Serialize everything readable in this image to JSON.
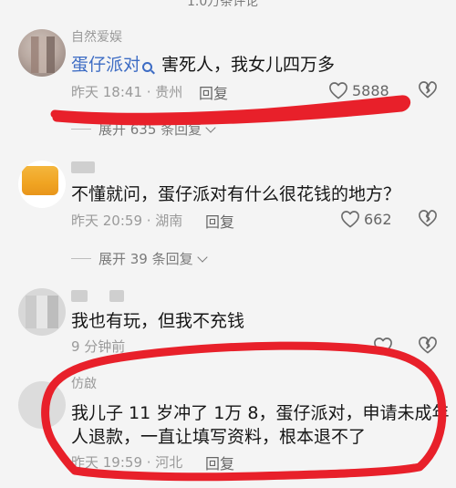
{
  "topbar": {
    "title": "1.0万条评论"
  },
  "comments": [
    {
      "username": "自然爱娱",
      "mention": "蛋仔派对",
      "text": " 害死人，我女儿四万多",
      "time": "昨天 18:41 · 贵州",
      "reply": "回复",
      "likes": "5888"
    },
    {
      "expand_hidden": "展开 635 条回复",
      "username": "",
      "text": "不懂就问，蛋仔派对有什么很花钱的地方？",
      "time": "昨天 20:59 · 湖南",
      "reply": "回复",
      "likes": "662",
      "expand": "展开 39 条回复"
    },
    {
      "username": "",
      "text": "我也有玩，但我不充钱",
      "time": "9 分钟前",
      "reply": "",
      "likes": ""
    },
    {
      "username": "仿啟",
      "text_line1": "我儿子 11 岁冲了 1万 8，蛋仔派对，申请未成年",
      "text_line2": "人退款，一直让填写资料，根本退不了",
      "time": "昨天 19:59 · 河北",
      "reply": "回复"
    }
  ],
  "icons": {
    "like": "heart-outline-icon",
    "dislike": "broken-heart-icon",
    "expand": "chevron-down-icon",
    "mention": "search-icon"
  },
  "colors": {
    "background": "#f4f4f4",
    "mention": "#3d6cc4",
    "annotation": "#e8202a"
  }
}
